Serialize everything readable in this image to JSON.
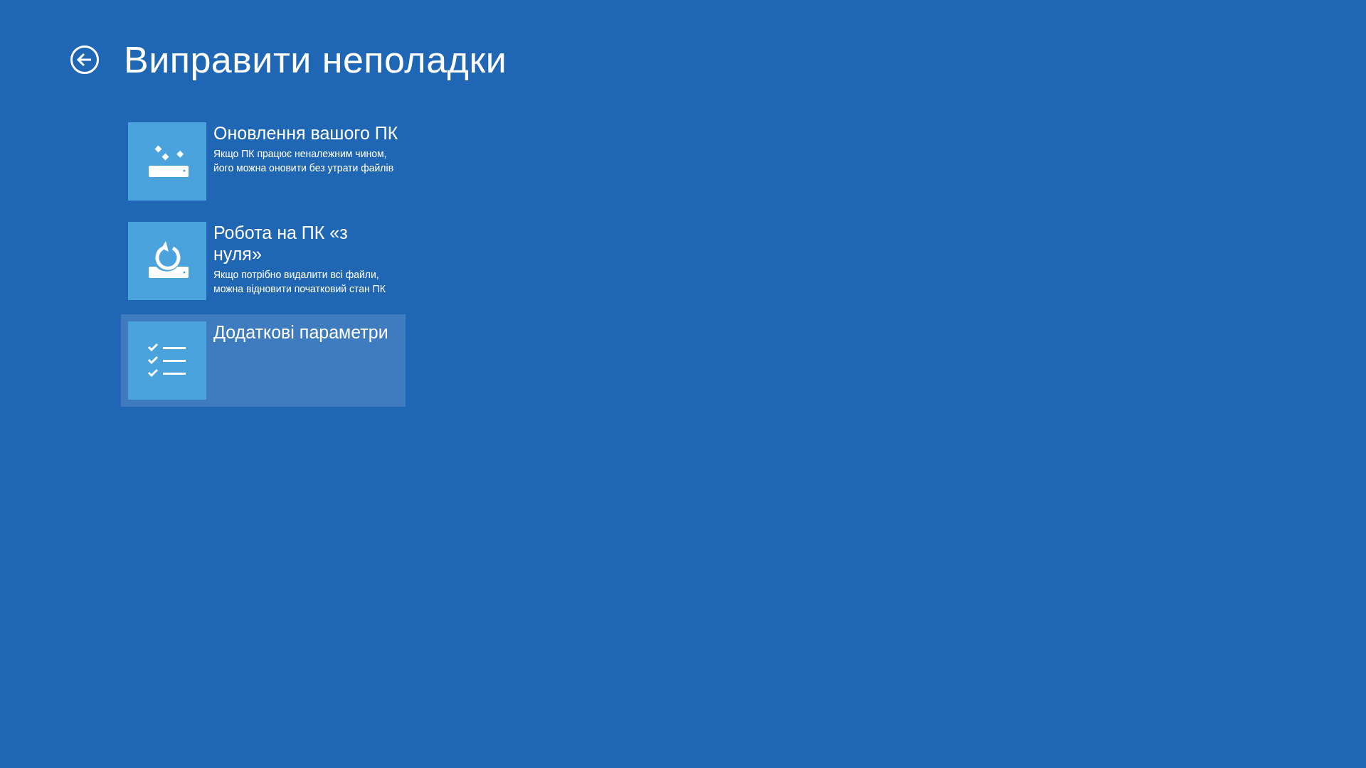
{
  "header": {
    "title": "Виправити неполадки"
  },
  "options": [
    {
      "kind": "refresh",
      "title": "Оновлення вашого ПК",
      "description": "Якщо ПК працює неналежним чином, його можна оновити без утрати файлів",
      "selected": false
    },
    {
      "kind": "reset",
      "title": "Робота на ПК «з нуля»",
      "description": "Якщо потрібно видалити всі файли, можна відновити початковий стан ПК",
      "selected": false
    },
    {
      "kind": "advanced",
      "title": "Додаткові параметри",
      "selected": true
    }
  ]
}
